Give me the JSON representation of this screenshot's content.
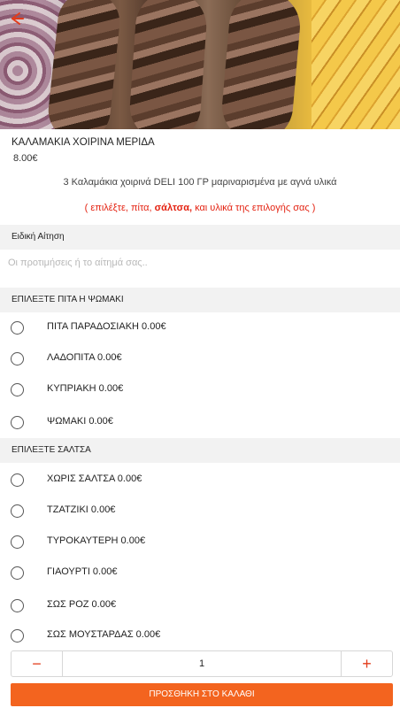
{
  "product": {
    "title": "ΚΑΛΑΜΑΚΙΑ ΧΟΙΡΙΝΑ ΜΕΡΙΔΑ",
    "price": "8.00€",
    "description": "3 Καλαμάκια χοιρινά DELI 100 ΓΡ μαριναρισμένα με αγνά υλικά",
    "note_before": "( επιλέξτε, πίτα, ",
    "note_bold": "σάλτσα,",
    "note_after": " και υλικά της επιλογής σας )"
  },
  "special_request": {
    "header": "Ειδική Αίτηση",
    "placeholder": "Οι προτιμήσεις ή το αίτημά σας.."
  },
  "pita_group": {
    "header": "ΕΠΙΛΕΞΤΕ ΠΙΤΑ Η ΨΩΜΑΚΙ",
    "options": [
      {
        "label": "ΠΙΤΑ ΠΑΡΑΔΟΣΙΑΚΗ  0.00€"
      },
      {
        "label": "ΛΑΔΟΠΙΤΑ  0.00€"
      },
      {
        "label": "ΚΥΠΡΙΑΚΗ  0.00€"
      },
      {
        "label": "ΨΩΜΑΚΙ  0.00€"
      }
    ]
  },
  "sauce_group": {
    "header": "ΕΠΙΛΕΞΤΕ ΣΑΛΤΣΑ",
    "options": [
      {
        "label": "ΧΩΡΙΣ ΣΑΛΤΣΑ  0.00€"
      },
      {
        "label": "ΤΖΑΤΖΙΚΙ  0.00€"
      },
      {
        "label": "ΤΥΡΟΚΑΥΤΕΡΗ  0.00€"
      },
      {
        "label": "ΓΙΑΟΥΡΤΙ  0.00€"
      },
      {
        "label": "ΣΩΣ ΡΟΖ  0.00€"
      },
      {
        "label": "ΣΩΣ ΜΟΥΣΤΑΡΔΑΣ  0.00€"
      }
    ]
  },
  "footer": {
    "minus": "−",
    "quantity": "1",
    "plus": "+",
    "add_label": "ΠΡΟΣΘΗΚΗ ΣΤΟ ΚΑΛΑΘΙ"
  },
  "icons": {
    "back": "arrow-left-icon"
  },
  "colors": {
    "accent": "#e23b1a",
    "add_button": "#f3641f",
    "note_text": "#e42312",
    "section_bg": "#f2f2f2"
  }
}
